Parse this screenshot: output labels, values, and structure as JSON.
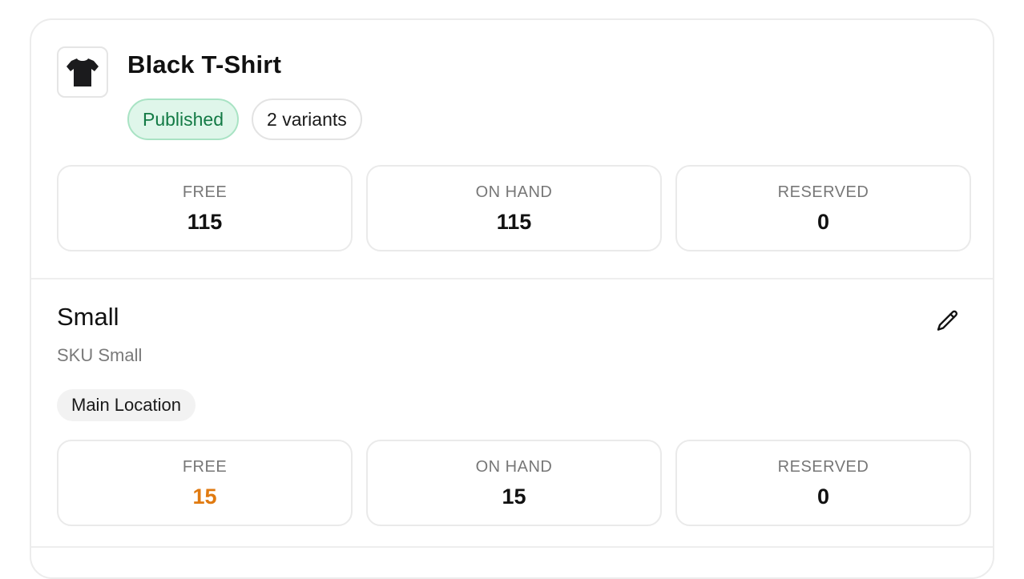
{
  "product": {
    "title": "Black T-Shirt",
    "thumbnail_icon": "tshirt-icon",
    "status_badge": "Published",
    "variants_badge": "2 variants",
    "stats": [
      {
        "label": "FREE",
        "value": "115"
      },
      {
        "label": "ON HAND",
        "value": "115"
      },
      {
        "label": "RESERVED",
        "value": "0"
      }
    ]
  },
  "variant": {
    "name": "Small",
    "sku": "SKU Small",
    "location": "Main Location",
    "edit_icon": "pencil-icon",
    "stats": [
      {
        "label": "FREE",
        "value": "15"
      },
      {
        "label": "ON HAND",
        "value": "15"
      },
      {
        "label": "RESERVED",
        "value": "0"
      }
    ]
  },
  "colors": {
    "published_bg": "#dff6ea",
    "published_text": "#137a45",
    "low_stock": "#e07a10"
  }
}
